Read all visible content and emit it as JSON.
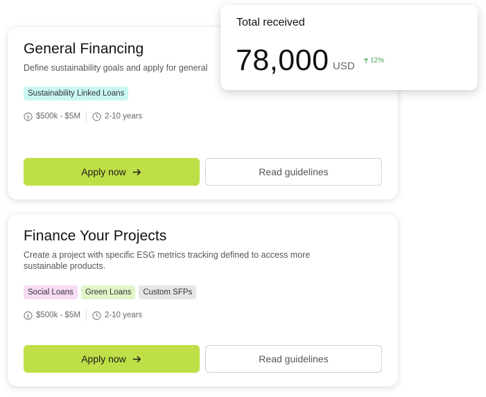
{
  "general_financing": {
    "title": "General Financing",
    "description": "Define sustainability goals and apply for general",
    "tags": [
      "Sustainability Linked Loans"
    ],
    "amount_range": "$500k - $5M",
    "duration": "2-10 years",
    "apply_label": "Apply now",
    "guidelines_label": "Read guidelines"
  },
  "finance_projects": {
    "title": "Finance Your Projects",
    "description": "Create a project with specific ESG metrics tracking defined to access more sustainable products.",
    "tags": [
      "Social Loans",
      "Green Loans",
      "Custom SFPs"
    ],
    "amount_range": "$500k - $5M",
    "duration": "2-10 years",
    "apply_label": "Apply now",
    "guidelines_label": "Read guidelines"
  },
  "total_received": {
    "label": "Total received",
    "value": "78,000",
    "unit": "USD",
    "change": "12%"
  },
  "colors": {
    "accent": "#bedf47",
    "positive": "#3fa34d",
    "tag_teal": "#c9f7f3",
    "tag_pink": "#f7dcf6",
    "tag_green": "#e3f4c8",
    "tag_grey": "#e6e6e6"
  },
  "icons": [
    "dollar-coin-icon",
    "clock-icon",
    "arrow-right-icon",
    "arrow-up-icon"
  ]
}
